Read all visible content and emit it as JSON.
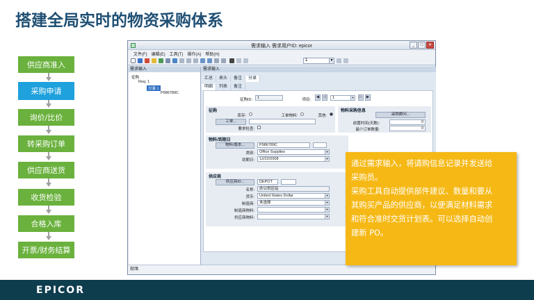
{
  "slide": {
    "title": "搭建全局实时的物资采购体系",
    "footer_logo": "EPICOR"
  },
  "flow": {
    "steps": [
      "供应商准入",
      "采购申请",
      "询价/比价",
      "转采购订单",
      "供应商送货",
      "收货检验",
      "合格入库",
      "开票/财务结算"
    ],
    "active_index": 1,
    "colors": {
      "step": "#6ab13d",
      "active": "#1ea1dc"
    }
  },
  "window": {
    "title": "需求输入 需求用户ID: epicor",
    "menu": [
      "文件(F)",
      "编辑(E)",
      "工具(T)",
      "操作(A)",
      "帮助(H)"
    ],
    "toolbar_combo": "1",
    "tree_header": "需求输入",
    "content_header": "需求输入",
    "tree": {
      "root": "征购",
      "req": "Req. 1",
      "line": "分录 1",
      "part": "P986789C"
    },
    "top_tabs": [
      "汇总",
      "表头",
      "备注",
      "分录"
    ],
    "sub_tabs": [
      "明细",
      "列表",
      "备注"
    ],
    "req_id_label": "征购ID:",
    "req_id": "1",
    "line_label": "项目:",
    "line_value": "1",
    "req_group": {
      "title": "征购",
      "inventory": "库存:",
      "job_material": "工单物料:",
      "other": "其他:",
      "job_button": "工单...",
      "inspection": "要求检查:"
    },
    "material_info": {
      "title": "物料采购信息",
      "purchase_button": "采购顾问...",
      "lead_time_label": "前置时间(天数):",
      "lead_time": "0",
      "min_qty_label": "最少订单数量:",
      "min_qty": "0"
    },
    "part_group": {
      "title": "物料/到期日",
      "part_button": "物料/版本...",
      "part": "P986789C",
      "class_label": "类别:",
      "class": "Office Supplies",
      "due_label": "到期日:",
      "due": "12/22/2008"
    },
    "supplier_group": {
      "title": "供应商",
      "supplier_button": "供应商ID...",
      "supplier_id": "DEPOT",
      "name_label": "名称:",
      "name": "办公供应站",
      "currency_label": "货币:",
      "currency": "United States Dollar",
      "manufacturer_label": "制造商:",
      "manufacturer": "未选择",
      "mfg_part_label": "制造商物料:",
      "mfg_part": "",
      "supplier_part_label": "供应商物料:",
      "supplier_part": ""
    },
    "status": "就绪"
  },
  "callout": {
    "lines": [
      "通过需求输入，将请购信息记录并发送给",
      "采购员。",
      "采购工具自动提供部件建议、数量和要从",
      "其购买产品的供应商，以便满足材料需求",
      "和符合准时交货计划表。可以选择自动创",
      "建新 PO。"
    ],
    "color": "#f5b815"
  }
}
